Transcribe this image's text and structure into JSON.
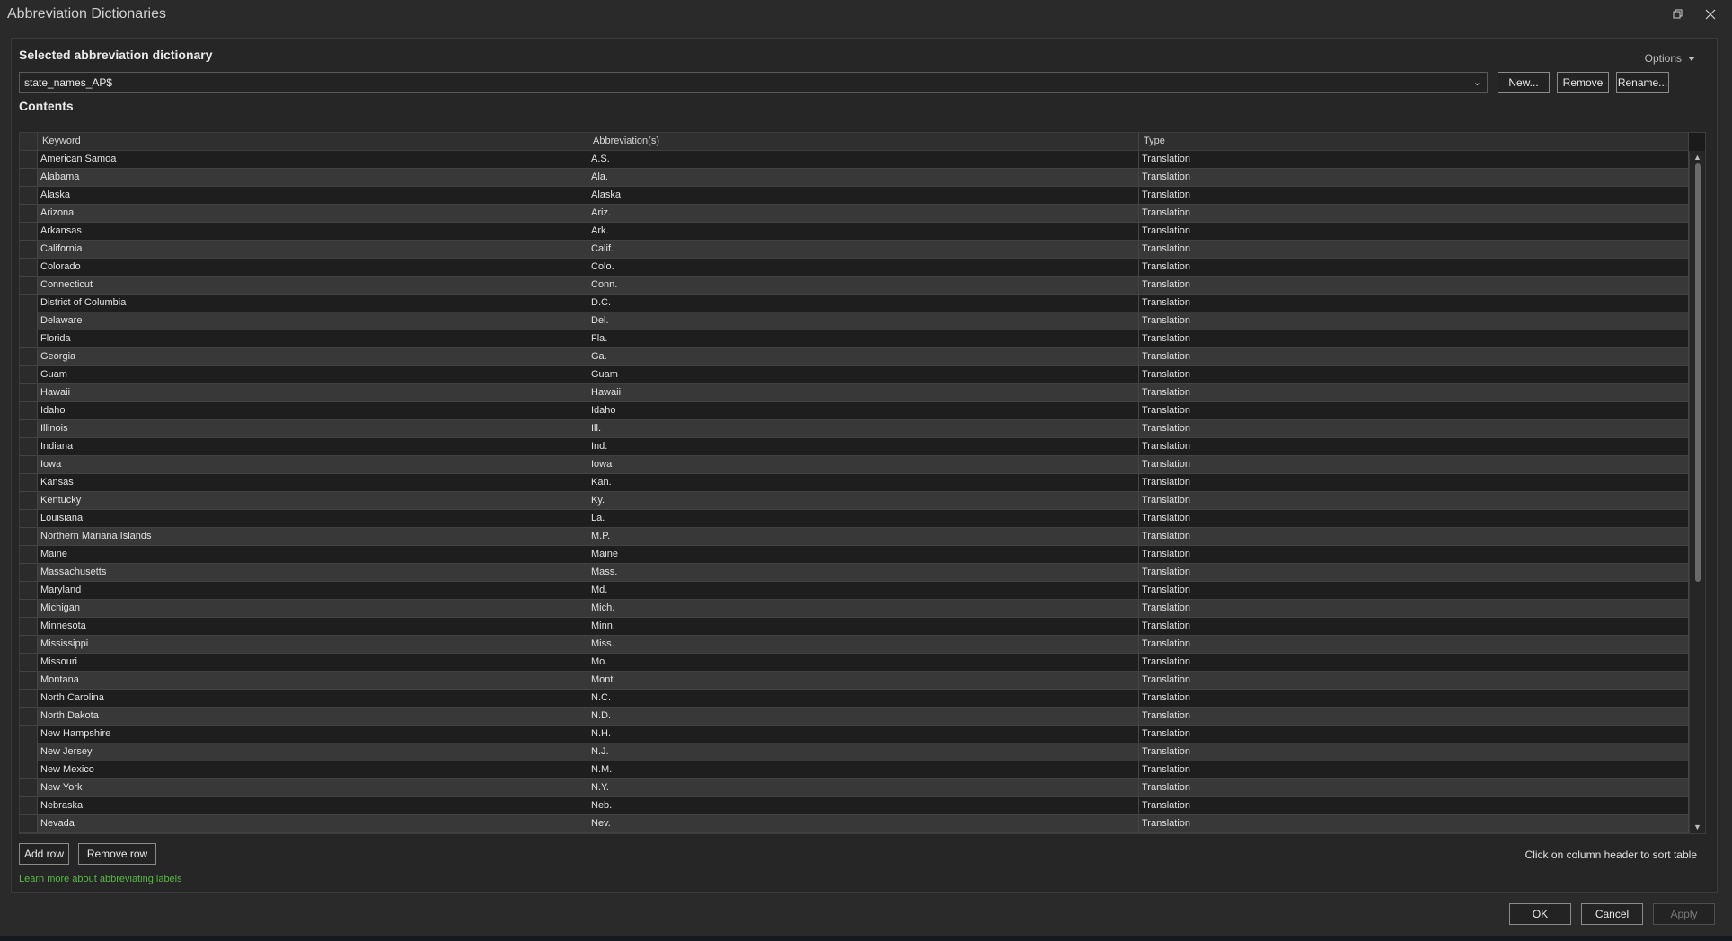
{
  "window": {
    "title": "Abbreviation Dictionaries"
  },
  "selected_section": {
    "title": "Selected abbreviation dictionary",
    "options_label": "Options",
    "dictionary_value": "state_names_AP$",
    "new_label": "New...",
    "remove_label": "Remove",
    "rename_label": "Rename..."
  },
  "contents": {
    "title": "Contents",
    "columns": [
      "Keyword",
      "Abbreviation(s)",
      "Type"
    ],
    "rows": [
      {
        "keyword": "American Samoa",
        "abbr": "A.S.",
        "type": "Translation"
      },
      {
        "keyword": "Alabama",
        "abbr": "Ala.",
        "type": "Translation"
      },
      {
        "keyword": "Alaska",
        "abbr": "Alaska",
        "type": "Translation"
      },
      {
        "keyword": "Arizona",
        "abbr": "Ariz.",
        "type": "Translation"
      },
      {
        "keyword": "Arkansas",
        "abbr": "Ark.",
        "type": "Translation"
      },
      {
        "keyword": "California",
        "abbr": "Calif.",
        "type": "Translation"
      },
      {
        "keyword": "Colorado",
        "abbr": "Colo.",
        "type": "Translation"
      },
      {
        "keyword": "Connecticut",
        "abbr": "Conn.",
        "type": "Translation"
      },
      {
        "keyword": "District of Columbia",
        "abbr": "D.C.",
        "type": "Translation"
      },
      {
        "keyword": "Delaware",
        "abbr": "Del.",
        "type": "Translation"
      },
      {
        "keyword": "Florida",
        "abbr": "Fla.",
        "type": "Translation"
      },
      {
        "keyword": "Georgia",
        "abbr": "Ga.",
        "type": "Translation"
      },
      {
        "keyword": "Guam",
        "abbr": "Guam",
        "type": "Translation"
      },
      {
        "keyword": "Hawaii",
        "abbr": "Hawaii",
        "type": "Translation"
      },
      {
        "keyword": "Idaho",
        "abbr": "Idaho",
        "type": "Translation"
      },
      {
        "keyword": "Illinois",
        "abbr": "Ill.",
        "type": "Translation"
      },
      {
        "keyword": "Indiana",
        "abbr": "Ind.",
        "type": "Translation"
      },
      {
        "keyword": "Iowa",
        "abbr": "Iowa",
        "type": "Translation"
      },
      {
        "keyword": "Kansas",
        "abbr": "Kan.",
        "type": "Translation"
      },
      {
        "keyword": "Kentucky",
        "abbr": "Ky.",
        "type": "Translation"
      },
      {
        "keyword": "Louisiana",
        "abbr": "La.",
        "type": "Translation"
      },
      {
        "keyword": "Northern Mariana Islands",
        "abbr": "M.P.",
        "type": "Translation"
      },
      {
        "keyword": "Maine",
        "abbr": "Maine",
        "type": "Translation"
      },
      {
        "keyword": "Massachusetts",
        "abbr": "Mass.",
        "type": "Translation"
      },
      {
        "keyword": "Maryland",
        "abbr": "Md.",
        "type": "Translation"
      },
      {
        "keyword": "Michigan",
        "abbr": "Mich.",
        "type": "Translation"
      },
      {
        "keyword": "Minnesota",
        "abbr": "Minn.",
        "type": "Translation"
      },
      {
        "keyword": "Mississippi",
        "abbr": "Miss.",
        "type": "Translation"
      },
      {
        "keyword": "Missouri",
        "abbr": "Mo.",
        "type": "Translation"
      },
      {
        "keyword": "Montana",
        "abbr": "Mont.",
        "type": "Translation"
      },
      {
        "keyword": "North Carolina",
        "abbr": "N.C.",
        "type": "Translation"
      },
      {
        "keyword": "North Dakota",
        "abbr": "N.D.",
        "type": "Translation"
      },
      {
        "keyword": "New Hampshire",
        "abbr": "N.H.",
        "type": "Translation"
      },
      {
        "keyword": "New Jersey",
        "abbr": "N.J.",
        "type": "Translation"
      },
      {
        "keyword": "New Mexico",
        "abbr": "N.M.",
        "type": "Translation"
      },
      {
        "keyword": "New York",
        "abbr": "N.Y.",
        "type": "Translation"
      },
      {
        "keyword": "Nebraska",
        "abbr": "Neb.",
        "type": "Translation"
      },
      {
        "keyword": "Nevada",
        "abbr": "Nev.",
        "type": "Translation"
      }
    ]
  },
  "footer": {
    "add_row_label": "Add row",
    "remove_row_label": "Remove row",
    "sort_hint": "Click on column header to sort table",
    "learn_more": "Learn more about abbreviating labels",
    "ok_label": "OK",
    "cancel_label": "Cancel",
    "apply_label": "Apply"
  },
  "colors": {
    "link": "#58b848",
    "background": "#2a2a2a"
  },
  "icons": {
    "restore": "restore-icon",
    "close": "close-icon",
    "dropdown": "chevron-down-icon"
  }
}
